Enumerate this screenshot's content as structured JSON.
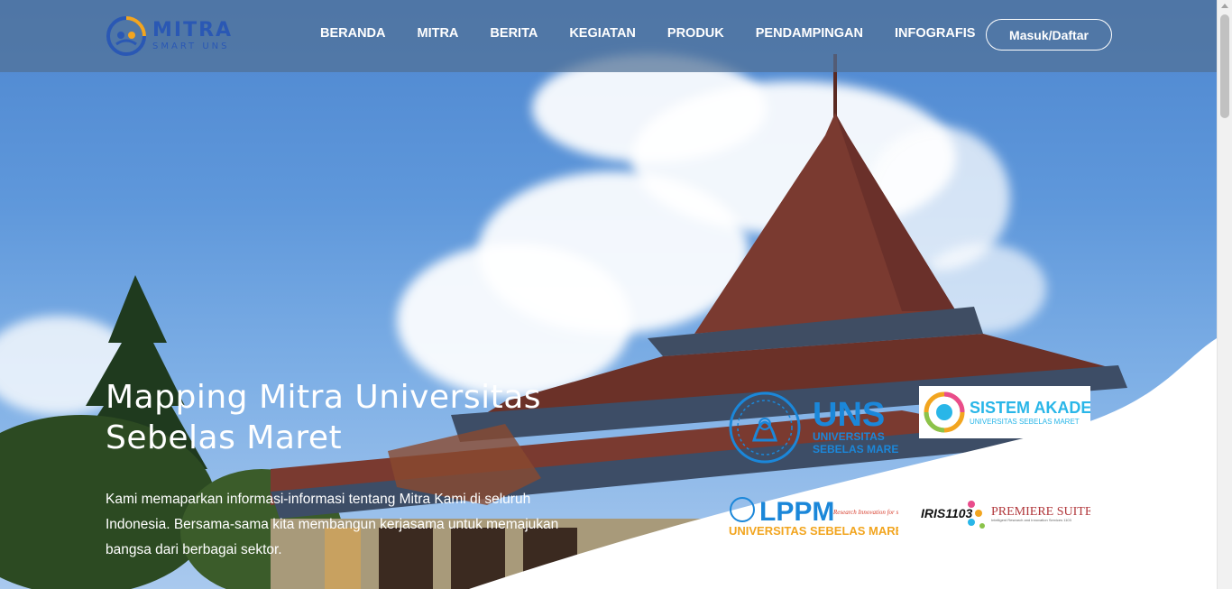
{
  "brand": {
    "name": "MITRA",
    "tagline": "SMART UNS",
    "accent_color": "#2a58b4"
  },
  "nav": {
    "items": [
      "BERANDA",
      "MITRA",
      "BERITA",
      "KEGIATAN",
      "PRODUK",
      "PENDAMPINGAN",
      "INFOGRAFIS"
    ],
    "login_label": "Masuk/Daftar"
  },
  "hero": {
    "title": "Mapping Mitra Universitas Sebelas Maret",
    "description": "Kami memaparkan informasi-informasi tentang Mitra Kami di seluruh Indonesia. Bersama-sama kita membangun kerjasama untuk memajukan bangsa dari berbagai sektor."
  },
  "partners": {
    "uns": {
      "word": "UNS",
      "line1": "UNIVERSITAS",
      "line2": "SEBELAS MARET",
      "color": "#1b87d9"
    },
    "siakad": {
      "word": "SISTEM AKADEMIK",
      "sub": "UNIVERSITAS SEBELAS MARET",
      "color": "#29b6e8"
    },
    "lppm": {
      "word": "LPPM",
      "sub": "UNIVERSITAS SEBELAS MARET",
      "tag": "Research Innovation for society"
    },
    "iris": {
      "word": "IRIS1103",
      "brand": "PREMIERE SUITE",
      "sub": "Intelligent Research and Innovation Services 1103"
    }
  },
  "icons": [
    "mitra-logo-icon",
    "scroll-up-icon"
  ]
}
